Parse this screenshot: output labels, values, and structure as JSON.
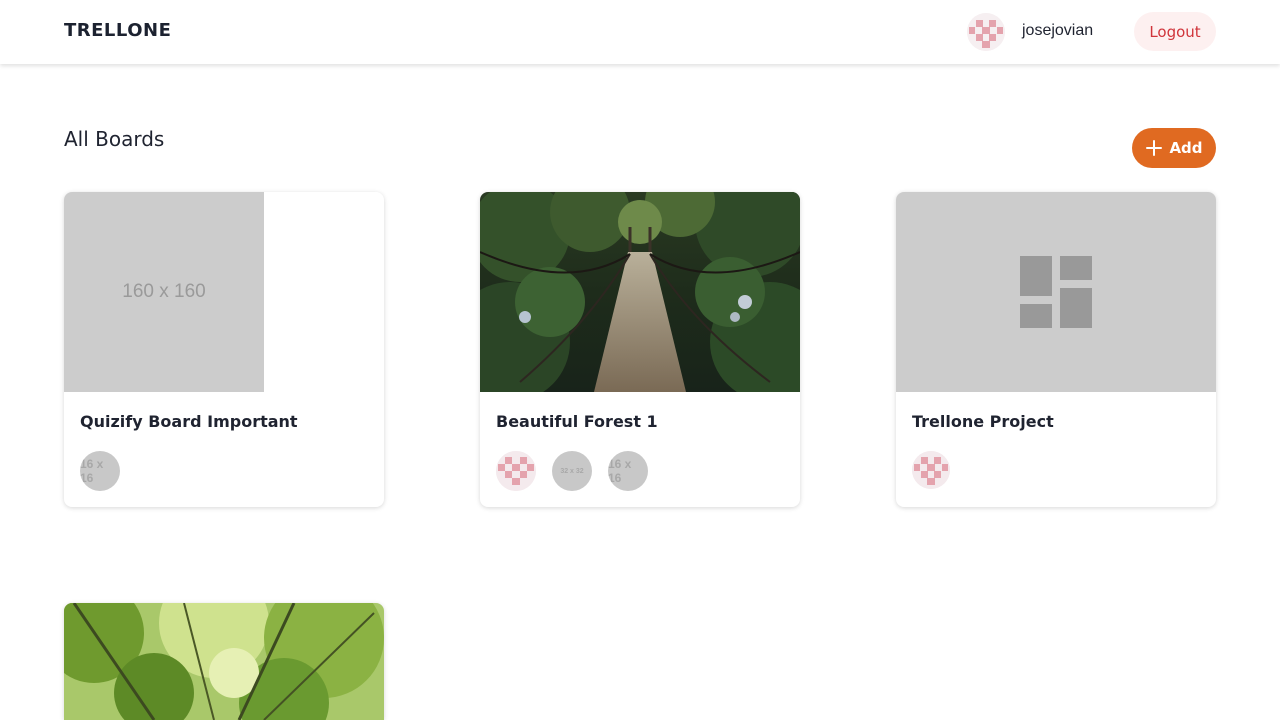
{
  "app": {
    "brand": "TRELLONE"
  },
  "nav": {
    "username": "josejovian",
    "logout_label": "Logout"
  },
  "boards_section": {
    "title": "All Boards",
    "add_label": "Add"
  },
  "boards": [
    {
      "title": "Quizify Board Important",
      "cover": {
        "kind": "placeholder",
        "text": "160 x 160"
      },
      "members": [
        {
          "kind": "placeholder",
          "text": "16 x 16"
        }
      ]
    },
    {
      "title": "Beautiful Forest 1",
      "cover": {
        "kind": "photo",
        "subject": "forest-suspension-bridge"
      },
      "members": [
        {
          "kind": "identicon"
        },
        {
          "kind": "placeholder",
          "text": "32 x 32"
        },
        {
          "kind": "placeholder",
          "text": "16 x 16"
        }
      ]
    },
    {
      "title": "Trellone Project",
      "cover": {
        "kind": "default-icon",
        "icon": "board-layout-icon"
      },
      "members": [
        {
          "kind": "identicon"
        }
      ]
    },
    {
      "title": "",
      "cover": {
        "kind": "photo",
        "subject": "forest-canopy"
      },
      "members": []
    }
  ],
  "colors": {
    "accent": "#e06a21",
    "logout_text": "#d0343a",
    "logout_bg": "#fdf0f0",
    "identicon": "#e4a3ad"
  }
}
